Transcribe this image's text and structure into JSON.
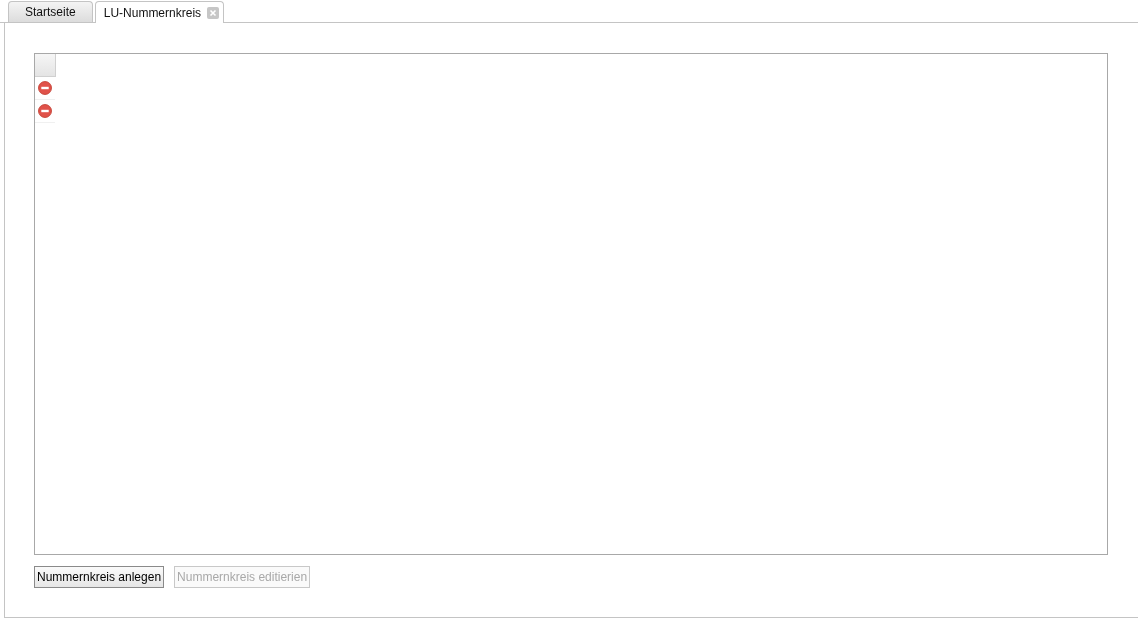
{
  "tabs": [
    {
      "label": "Startseite",
      "selected": false,
      "closable": false
    },
    {
      "label": "LU-Nummernkreis",
      "selected": true,
      "closable": true
    }
  ],
  "grid": {
    "rows": [
      {
        "kind": "remove"
      },
      {
        "kind": "remove"
      }
    ]
  },
  "buttons": [
    {
      "label": "Nummernkreis anlegen",
      "disabled": false
    },
    {
      "label": "Nummernkreis editierien",
      "disabled": true
    }
  ]
}
